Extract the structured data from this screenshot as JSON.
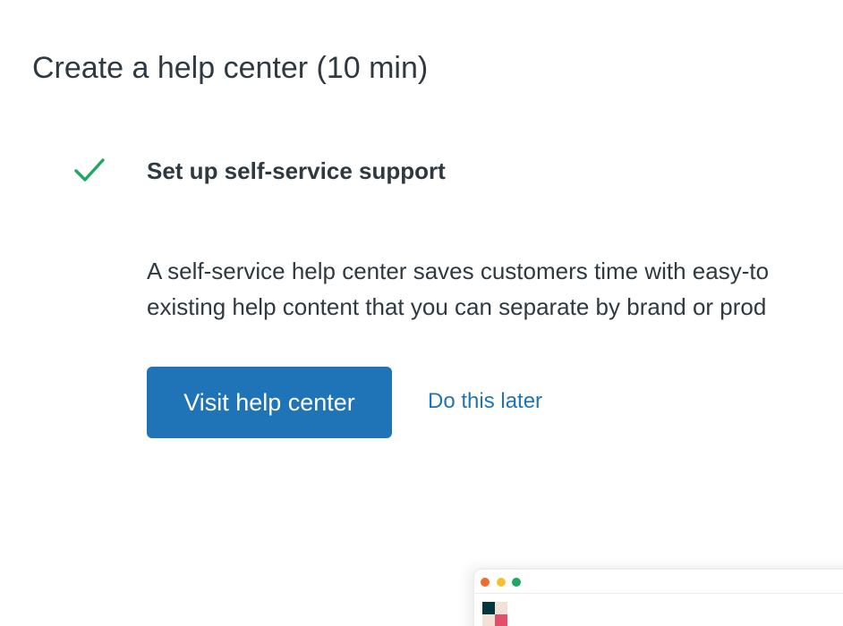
{
  "section": {
    "title": "Create a help center (10 min)"
  },
  "step": {
    "status_icon": "checkmark-icon",
    "status_color": "#1ea861",
    "title": "Set up self-service support",
    "description_lines": [
      "A self-service help center saves customers time with easy-to",
      "existing help content that you can separate by brand or prod"
    ],
    "primary_button": {
      "label": "Visit help center",
      "color": "#1f73b7"
    },
    "secondary_link": {
      "label": "Do this later",
      "color": "#1f73b7"
    }
  },
  "preview": {
    "window_controls": [
      "close-dot",
      "minimize-dot",
      "maximize-dot"
    ],
    "logo_icon": "brand-logo-icon"
  }
}
